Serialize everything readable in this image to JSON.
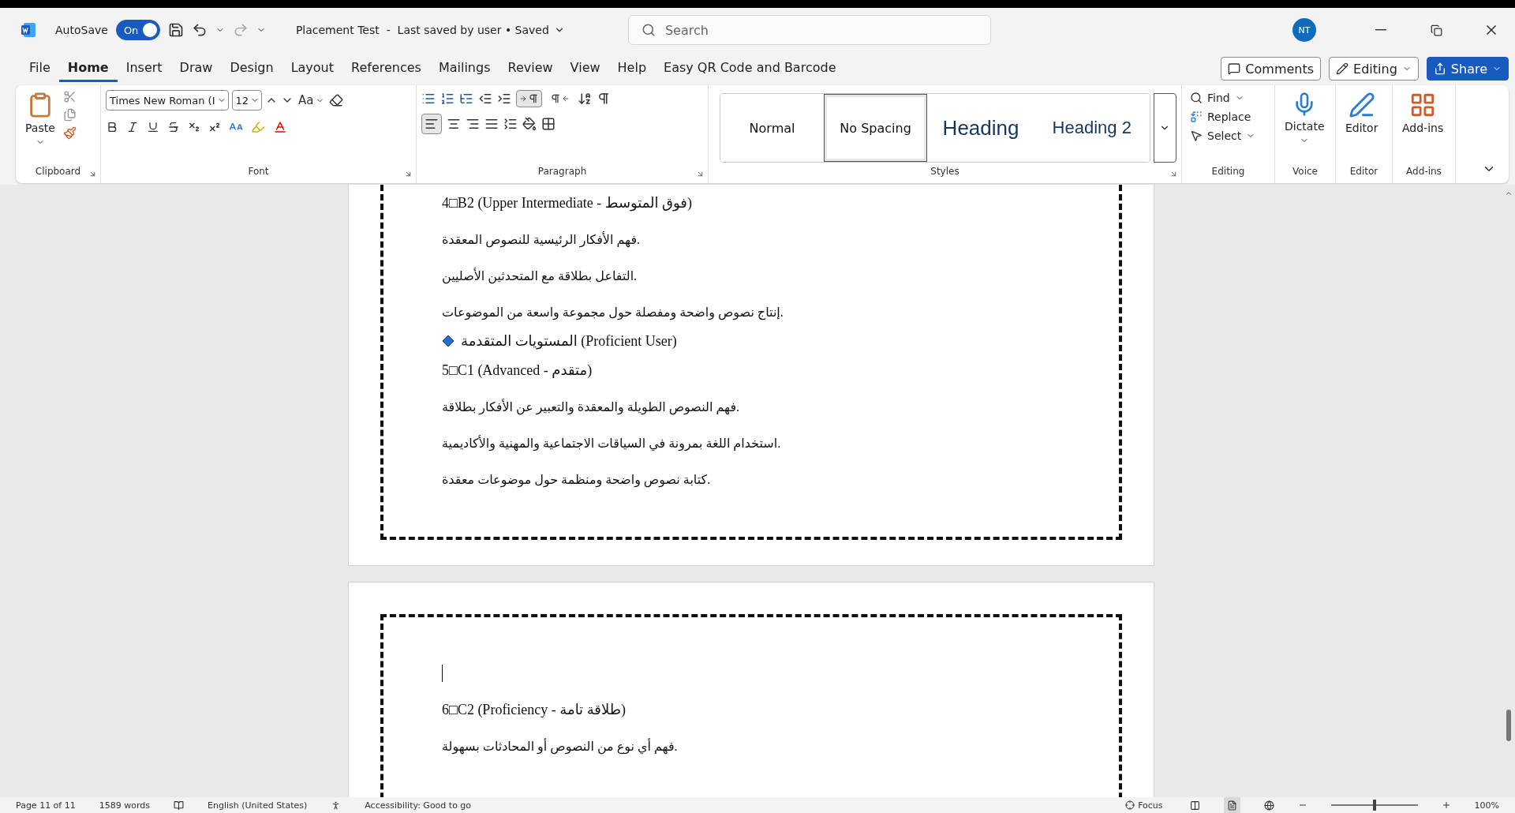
{
  "titlebar": {
    "autosave_label": "AutoSave",
    "autosave": {
      "label": "On",
      "on": true
    },
    "document_title": "Placement Test  -  Last saved by user • Saved",
    "search_placeholder": "Search",
    "avatar": "NT"
  },
  "menu_tabs": [
    {
      "label": "File",
      "selected": false
    },
    {
      "label": "Home",
      "selected": true
    },
    {
      "label": "Insert",
      "selected": false
    },
    {
      "label": "Draw",
      "selected": false
    },
    {
      "label": "Design",
      "selected": false
    },
    {
      "label": "Layout",
      "selected": false
    },
    {
      "label": "References",
      "selected": false
    },
    {
      "label": "Mailings",
      "selected": false
    },
    {
      "label": "Review",
      "selected": false
    },
    {
      "label": "View",
      "selected": false
    },
    {
      "label": "Help",
      "selected": false
    },
    {
      "label": "Easy QR Code and Barcode",
      "selected": false
    }
  ],
  "actions": {
    "comments": "Comments",
    "editing": "Editing",
    "share": "Share"
  },
  "ribbon": {
    "clipboard": {
      "paste": "Paste",
      "group": "Clipboard"
    },
    "font": {
      "name": "Times New Roman (I",
      "size": "12",
      "case": "Aa",
      "group": "Font"
    },
    "paragraph": {
      "group": "Paragraph",
      "ltr_selected": true,
      "align_left_selected": true
    },
    "styles": {
      "group": "Styles",
      "items": [
        {
          "label": "Normal",
          "kind": "normal",
          "selected": false
        },
        {
          "label": "No Spacing",
          "kind": "normal",
          "selected": true
        },
        {
          "label": "Heading",
          "kind": "heading1",
          "selected": false
        },
        {
          "label": "Heading 2",
          "kind": "heading2",
          "selected": false
        }
      ]
    },
    "editing": {
      "group": "Editing",
      "find": "Find",
      "replace": "Replace",
      "select": "Select"
    },
    "voice": {
      "group": "Voice",
      "dictate": "Dictate"
    },
    "editor": {
      "group": "Editor",
      "label": "Editor"
    },
    "addins": {
      "group": "Add-ins",
      "label": "Add-ins"
    }
  },
  "pages": [
    {
      "cursor": false,
      "lines": [
        {
          "kind": "level",
          "text": "4□B2 (Upper Intermediate - فوق المتوسط)"
        },
        {
          "kind": "body",
          "text": "فهم الأفكار الرئيسية للنصوص المعقدة."
        },
        {
          "kind": "body",
          "text": "التفاعل بطلاقة مع المتحدثين الأصليين."
        },
        {
          "kind": "body",
          "text": "إنتاج نصوص واضحة ومفصلة حول مجموعة واسعة من الموضوعات."
        },
        {
          "kind": "section",
          "text": "المستويات المتقدمة (Proficient User)"
        },
        {
          "kind": "level",
          "text": "5□C1 (Advanced - متقدم)"
        },
        {
          "kind": "body",
          "text": "فهم النصوص الطويلة والمعقدة والتعبير عن الأفكار بطلاقة."
        },
        {
          "kind": "body",
          "text": "استخدام اللغة بمرونة في السياقات الاجتماعية والمهنية والأكاديمية."
        },
        {
          "kind": "body",
          "text": "كتابة نصوص واضحة ومنظمة حول موضوعات معقدة."
        }
      ]
    },
    {
      "cursor": true,
      "lines": [
        {
          "kind": "level",
          "text": "6□C2 (Proficiency - طلاقة تامة)"
        },
        {
          "kind": "body",
          "text": "فهم أي نوع من النصوص أو المحادثات بسهولة."
        }
      ]
    }
  ],
  "status_bar": {
    "page": "Page 11 of 11",
    "words": "1589 words",
    "language": "English (United States)",
    "accessibility": "Accessibility: Good to go",
    "focus": "Focus",
    "zoom": {
      "level": 0.5,
      "label": "100%"
    }
  }
}
